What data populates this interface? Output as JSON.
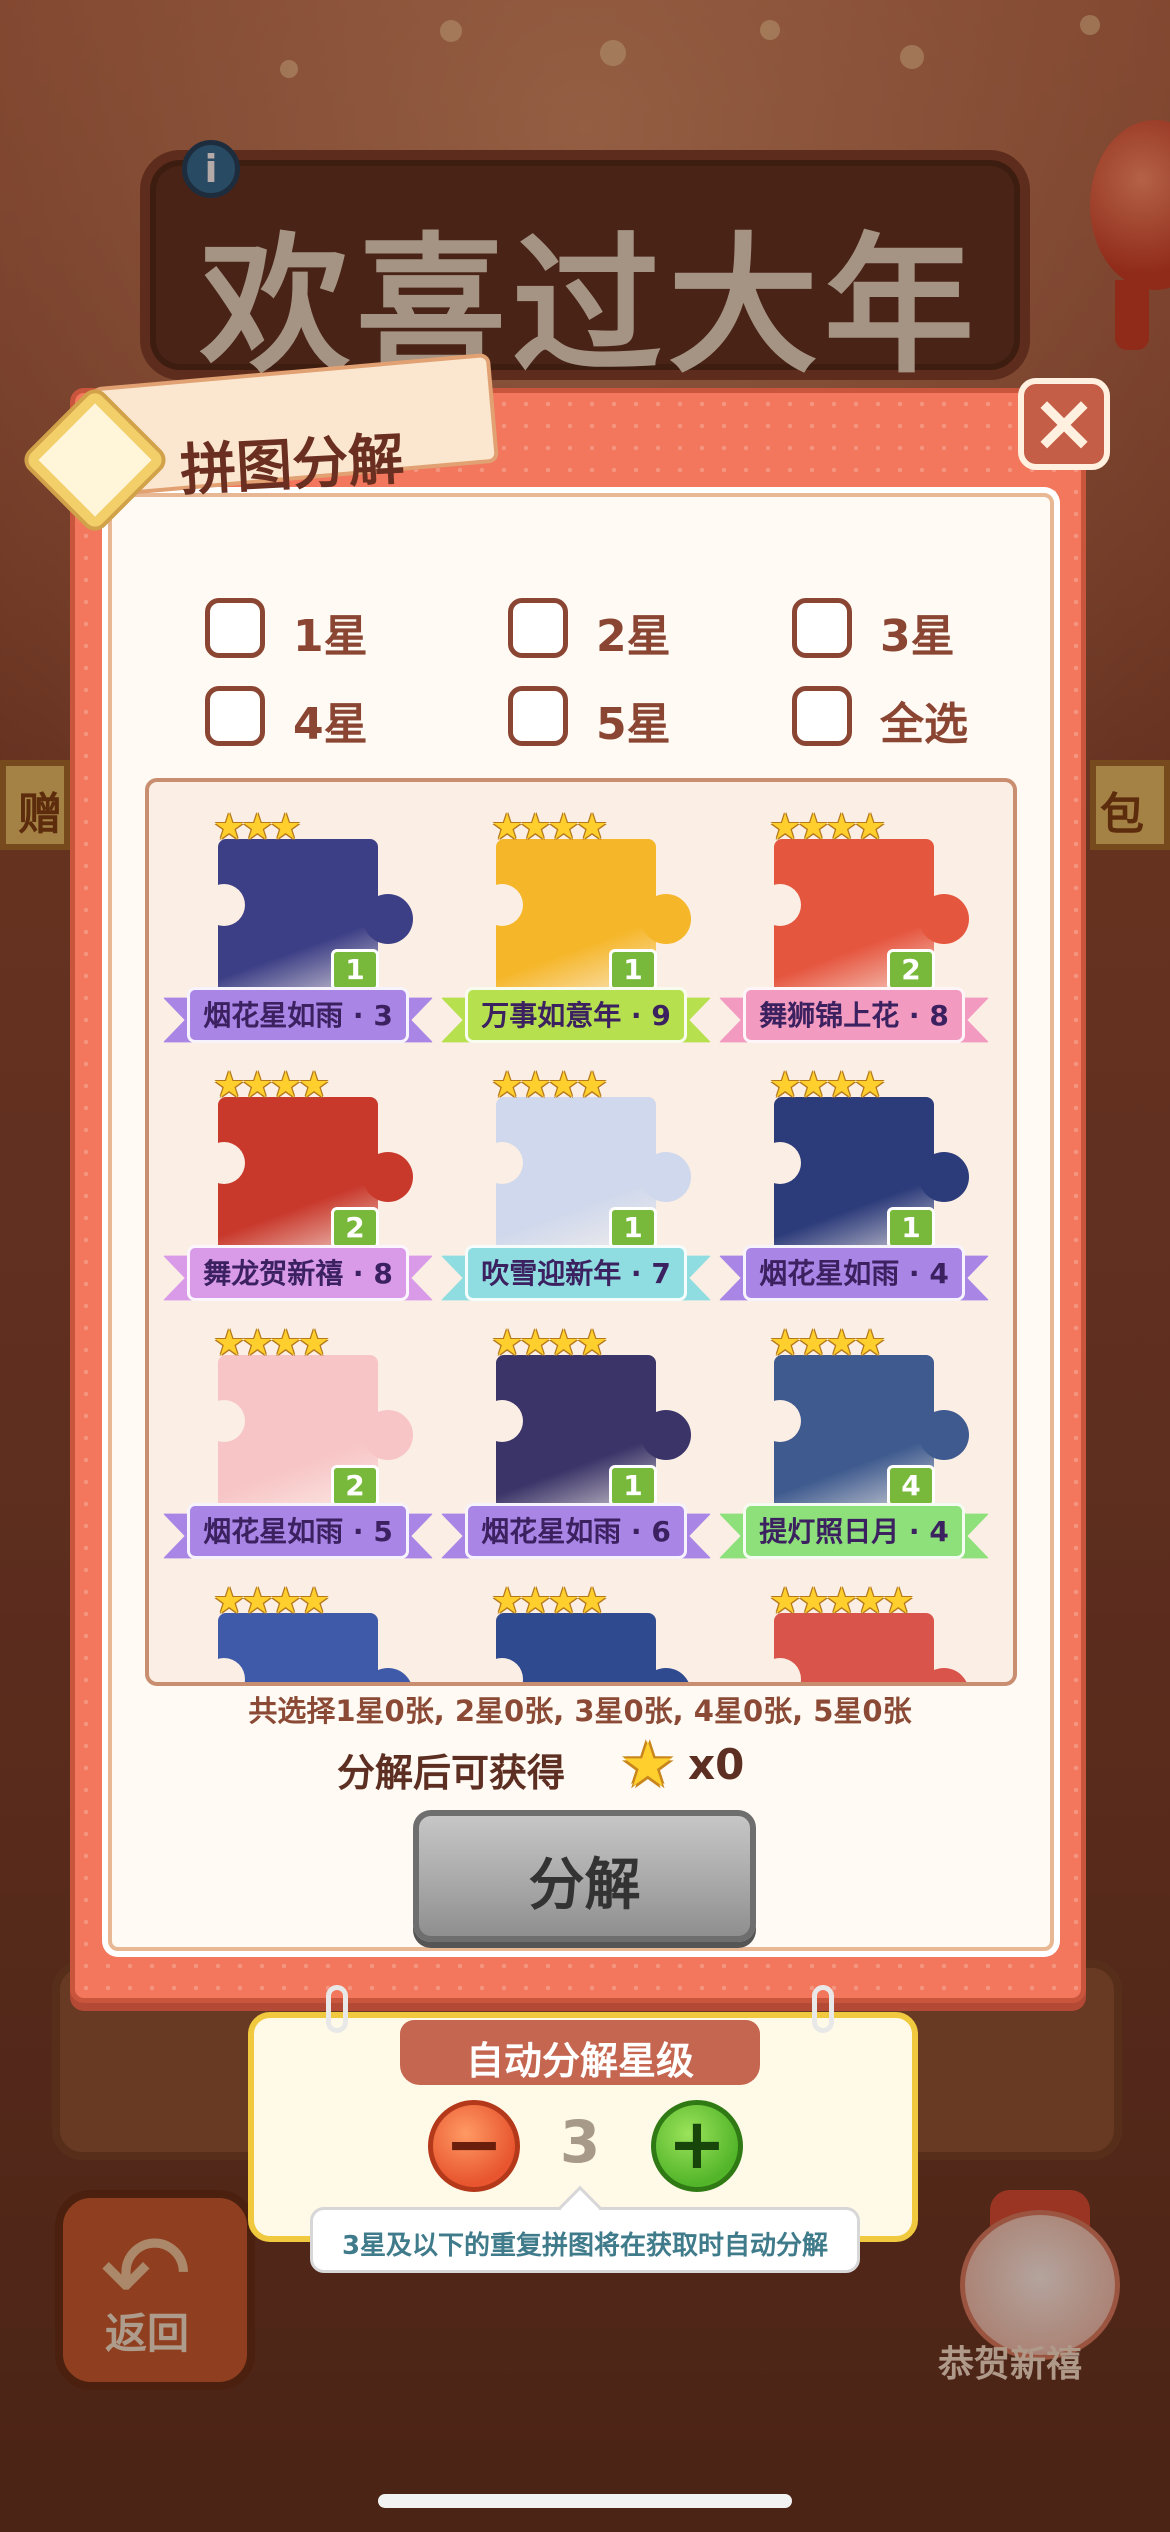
{
  "background": {
    "event_title": "欢喜过大年",
    "info_icon": "info-icon",
    "left_tab_text": "赠",
    "right_tab_text": "包",
    "return_label": "返回",
    "mascot_label": "恭贺新禧"
  },
  "dialog": {
    "title": "拼图分解",
    "close_icon": "close-icon",
    "filters": [
      {
        "label": "1星",
        "checked": false
      },
      {
        "label": "2星",
        "checked": false
      },
      {
        "label": "3星",
        "checked": false
      },
      {
        "label": "4星",
        "checked": false
      },
      {
        "label": "5星",
        "checked": false
      },
      {
        "label": "全选",
        "checked": false
      }
    ],
    "cards": [
      {
        "label": "烟花星如雨 · 3",
        "stars": 3,
        "count": "1",
        "art_color": "#3d3f86",
        "banner_color": "#a985e6"
      },
      {
        "label": "万事如意年 · 9",
        "stars": 4,
        "count": "1",
        "art_color": "#f5b62a",
        "banner_color": "#b7e04f"
      },
      {
        "label": "舞狮锦上花 · 8",
        "stars": 4,
        "count": "2",
        "art_color": "#e5563f",
        "banner_color": "#f39ac0"
      },
      {
        "label": "舞龙贺新禧 · 8",
        "stars": 4,
        "count": "2",
        "art_color": "#c8392c",
        "banner_color": "#d99be8"
      },
      {
        "label": "吹雪迎新年 · 7",
        "stars": 4,
        "count": "1",
        "art_color": "#cfd8ec",
        "banner_color": "#8fdde0"
      },
      {
        "label": "烟花星如雨 · 4",
        "stars": 4,
        "count": "1",
        "art_color": "#2c3b7a",
        "banner_color": "#a985e6"
      },
      {
        "label": "烟花星如雨 · 5",
        "stars": 4,
        "count": "2",
        "art_color": "#f7c5c5",
        "banner_color": "#a985e6"
      },
      {
        "label": "烟花星如雨 · 6",
        "stars": 4,
        "count": "1",
        "art_color": "#3a3468",
        "banner_color": "#a985e6"
      },
      {
        "label": "提灯照日月 · 4",
        "stars": 4,
        "count": "4",
        "art_color": "#3e5a8e",
        "banner_color": "#8ee07a"
      },
      {
        "label": "",
        "stars": 4,
        "count": "",
        "art_color": "#3e5aa8",
        "banner_color": "#a985e6"
      },
      {
        "label": "",
        "stars": 4,
        "count": "",
        "art_color": "#2f4a8f",
        "banner_color": "#a985e6"
      },
      {
        "label": "",
        "stars": 5,
        "count": "",
        "art_color": "#d9544a",
        "banner_color": "#f39ac0"
      }
    ],
    "summary": "共选择1星0张, 2星0张, 3星0张, 4星0张, 5星0张",
    "reward_label": "分解后可获得",
    "reward_icon": "star-icon",
    "reward_count": "x0",
    "decompose_label": "分解"
  },
  "auto_decompose": {
    "title": "自动分解星级",
    "minus_label": "−",
    "plus_label": "+",
    "level": "3",
    "tip": "3星及以下的重复拼图将在获取时自动分解"
  }
}
